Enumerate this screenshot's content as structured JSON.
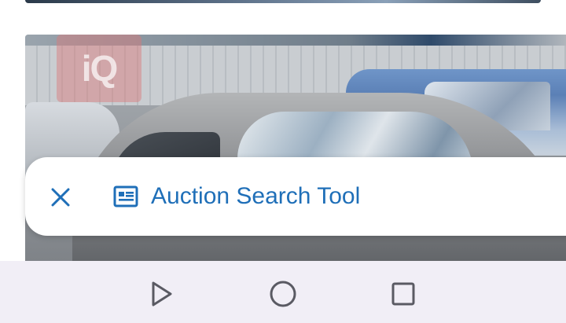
{
  "tool_bar": {
    "title": "Auction Search Tool",
    "close_icon": "close-icon",
    "article_icon": "article-icon",
    "accent_color": "#1f6fb8"
  },
  "photo": {
    "watermark_text": "iQ"
  },
  "nav_bar": {
    "back_icon": "back-triangle-icon",
    "home_icon": "home-circle-icon",
    "recents_icon": "recents-square-icon"
  }
}
